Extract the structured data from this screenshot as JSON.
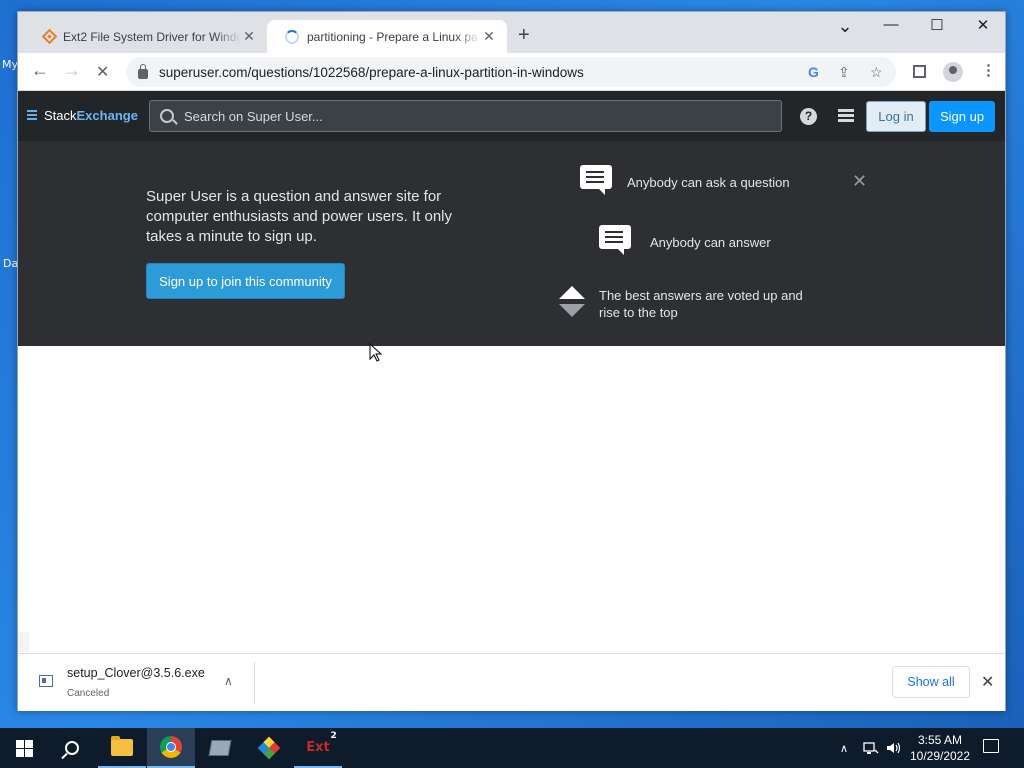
{
  "desktop": {
    "label_top": "My",
    "label_bottom": "Da"
  },
  "tabs": [
    {
      "title": "Ext2 File System Driver for Windo",
      "close": "✕"
    },
    {
      "title": "partitioning - Prepare a Linux pa",
      "close": "✕"
    }
  ],
  "new_tab": "+",
  "window_controls": {
    "tabsearch": "⌄",
    "minimize": "—",
    "maximize": "☐",
    "close": "✕"
  },
  "toolbar": {
    "back": "←",
    "forward": "→",
    "reload": "✕",
    "url": "superuser.com/questions/1022568/prepare-a-linux-partition-in-windows"
  },
  "site": {
    "logo_stack": "Stack",
    "logo_exchange": "Exchange",
    "search_placeholder": "Search on Super User...",
    "help": "?",
    "login": "Log in",
    "signup": "Sign up"
  },
  "hero": {
    "text": "Super User is a question and answer site for computer enthusiasts and power users. It only takes a minute to sign up.",
    "cta": "Sign up to join this community",
    "features": [
      "Anybody can ask a question",
      "Anybody can answer",
      "The best answers are voted up and rise to the top"
    ],
    "close": "✕"
  },
  "download": {
    "filename": "setup_Clover@3.5.6.exe",
    "status": "Canceled",
    "show_all": "Show all",
    "chevron": "∧",
    "close": "✕"
  },
  "taskbar": {
    "ext2_label": "Ext",
    "ext2_sup": "2",
    "time": "3:55 AM",
    "date": "10/29/2022",
    "tray_chevron": "∧"
  }
}
